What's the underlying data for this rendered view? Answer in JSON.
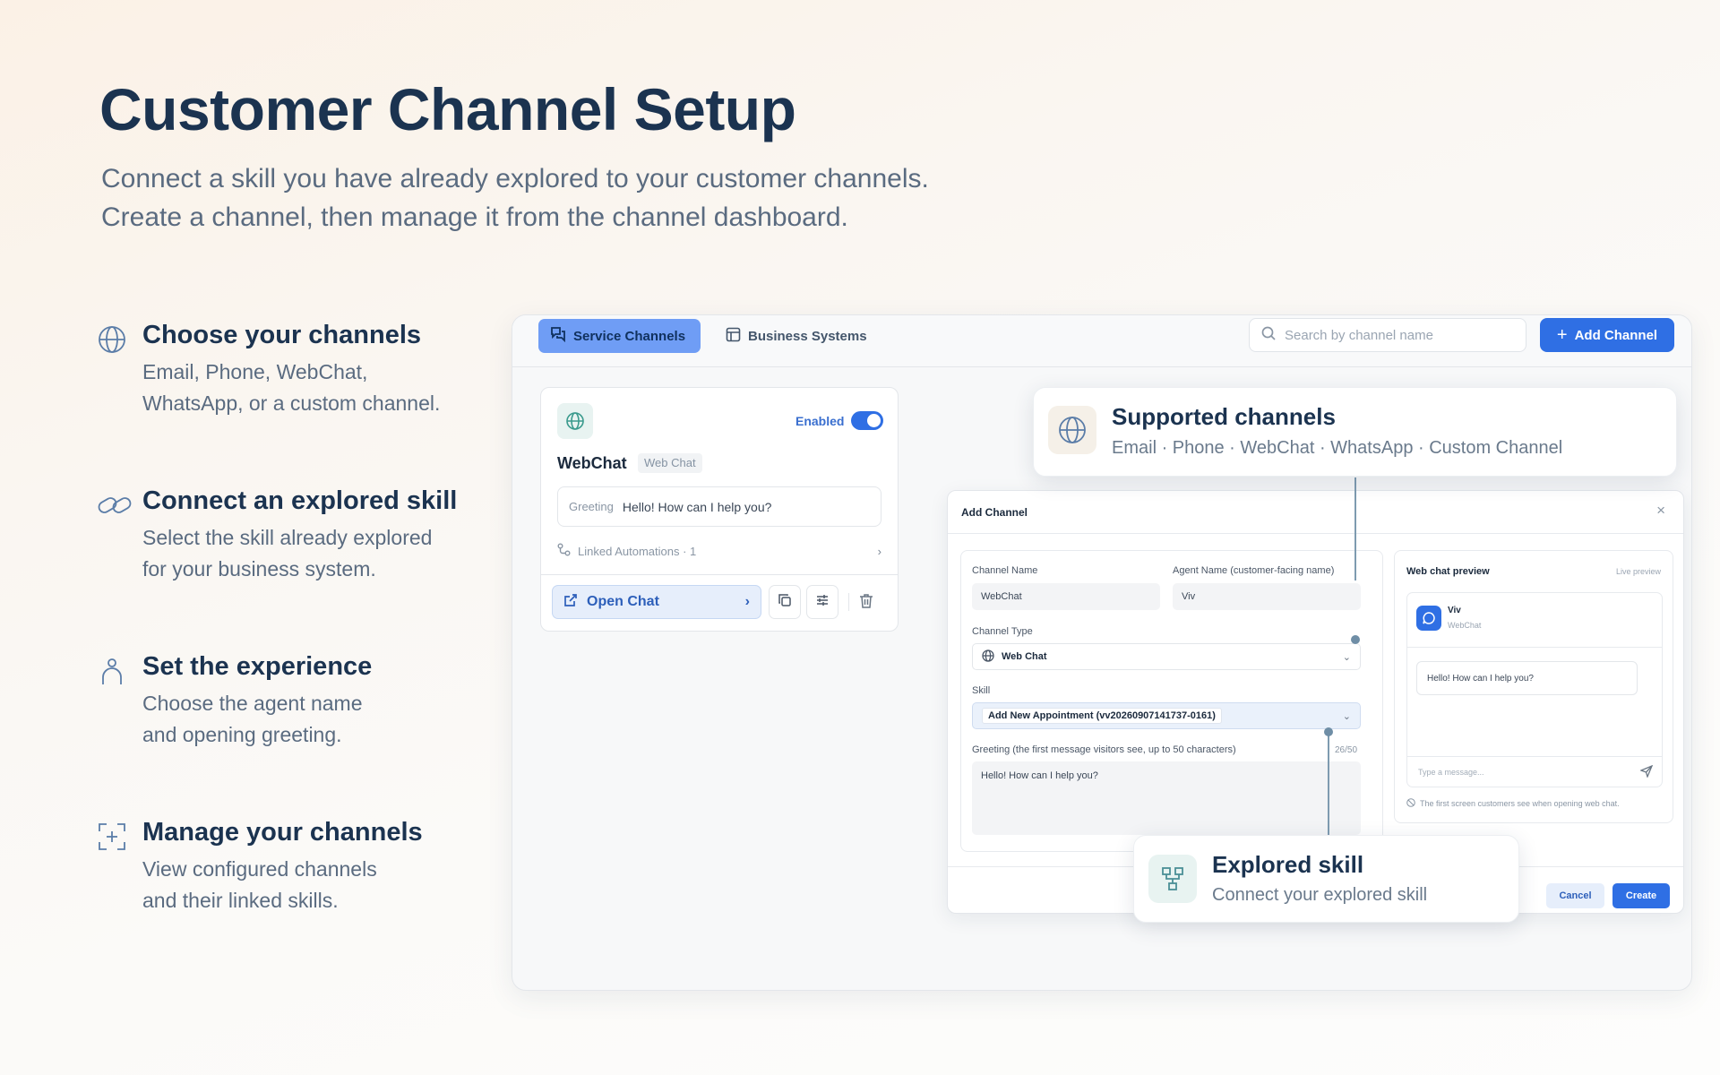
{
  "hero": {
    "title": "Customer Channel Setup",
    "subtitle_line1": "Connect a skill you have already explored to your customer channels.",
    "subtitle_line2": "Create a channel, then manage it from the channel dashboard."
  },
  "features": [
    {
      "icon": "globe-icon",
      "title": "Choose your channels",
      "desc_line1": "Email, Phone, WebChat,",
      "desc_line2": "WhatsApp, or a custom channel."
    },
    {
      "icon": "link-icon",
      "title": "Connect an explored skill",
      "desc_line1": "Select the skill already explored",
      "desc_line2": "for your business system."
    },
    {
      "icon": "person-icon",
      "title": "Set the experience",
      "desc_line1": "Choose the agent name",
      "desc_line2": "and opening greeting."
    },
    {
      "icon": "frame-plus-icon",
      "title": "Manage your channels",
      "desc_line1": "View configured channels",
      "desc_line2": "and their linked skills."
    }
  ],
  "app": {
    "tabs": [
      {
        "label": "Service Channels",
        "icon": "chat-icon",
        "active": true
      },
      {
        "label": "Business Systems",
        "icon": "layout-icon",
        "active": false
      }
    ],
    "search_placeholder": "Search by channel name",
    "add_button": "Add Channel",
    "accent": "#2f6fe4"
  },
  "card": {
    "status": "Enabled",
    "title": "WebChat",
    "badge": "Web Chat",
    "greeting_label": "Greeting",
    "greeting_value": "Hello! How can I help you?",
    "linked": "Linked Automations · 1",
    "open_chat": "Open Chat"
  },
  "supported": {
    "title": "Supported channels",
    "desc": "Email · Phone · WebChat · WhatsApp · Custom Channel"
  },
  "modal": {
    "title": "Add Channel",
    "close": "×",
    "channel_name_label": "Channel Name",
    "channel_name_value": "WebChat",
    "agent_name_label": "Agent Name (customer-facing name)",
    "agent_name_value": "Viv",
    "channel_type_label": "Channel Type",
    "channel_type_value": "Web Chat",
    "skill_label": "Skill",
    "skill_value": "Add New Appointment (vv20260907141737-0161)",
    "greeting_label": "Greeting (the first message visitors see, up to 50 characters)",
    "greeting_count": "26/50",
    "greeting_value": "Hello! How can I help you?",
    "cancel": "Cancel",
    "create": "Create"
  },
  "preview": {
    "title": "Web chat preview",
    "live": "Live preview",
    "agent_name": "Viv",
    "agent_sub": "WebChat",
    "bubble": "Hello! How can I help you?",
    "input_placeholder": "Type a message...",
    "note": "The first screen customers see when opening web chat."
  },
  "explored": {
    "title": "Explored skill",
    "desc": "Connect your explored skill"
  }
}
